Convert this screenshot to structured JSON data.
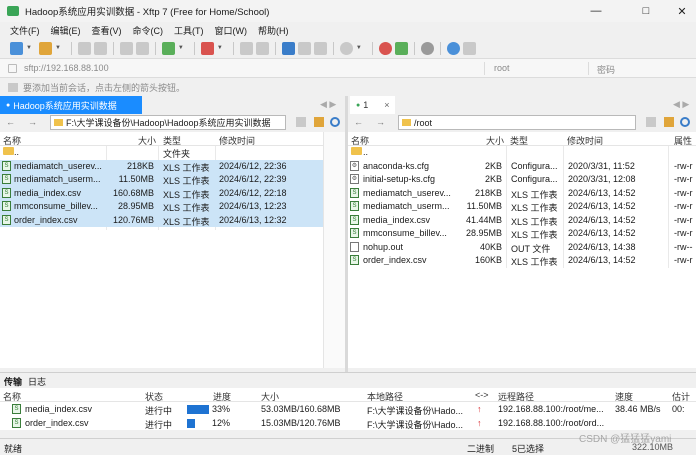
{
  "window": {
    "title": "Hadoop系统应用实训数据 - Xftp 7 (Free for Home/School)"
  },
  "menu": [
    "文件(F)",
    "编辑(E)",
    "查看(V)",
    "命令(C)",
    "工具(T)",
    "窗口(W)",
    "帮助(H)"
  ],
  "address": {
    "host_placeholder": "sftp://192.168.88.100",
    "user_placeholder": "root",
    "password_placeholder": "密码"
  },
  "hint": "要添加当前会话，点击左侧的箭头按钮。",
  "local": {
    "tab_label": "Hadoop系统应用实训数据",
    "path": "F:\\大学课设备份\\Hadoop\\Hadoop系统应用实训数据",
    "columns": {
      "name": "名称",
      "size": "大小",
      "type": "类型",
      "modified": "修改时间"
    },
    "rows": [
      {
        "name": "..",
        "size": "",
        "type": "文件夹",
        "modified": "",
        "kind": "folder"
      },
      {
        "name": "mediamatch_userev...",
        "size": "218KB",
        "type": "XLS 工作表",
        "modified": "2024/6/12, 22:36",
        "kind": "sheet"
      },
      {
        "name": "mediamatch_userm...",
        "size": "11.50MB",
        "type": "XLS 工作表",
        "modified": "2024/6/12, 22:39",
        "kind": "sheet"
      },
      {
        "name": "media_index.csv",
        "size": "160.68MB",
        "type": "XLS 工作表",
        "modified": "2024/6/12, 22:18",
        "kind": "sheet"
      },
      {
        "name": "mmconsume_billev...",
        "size": "28.95MB",
        "type": "XLS 工作表",
        "modified": "2024/6/13, 12:23",
        "kind": "sheet"
      },
      {
        "name": "order_index.csv",
        "size": "120.76MB",
        "type": "XLS 工作表",
        "modified": "2024/6/13, 12:32",
        "kind": "sheet"
      }
    ]
  },
  "remote": {
    "tab_label": "1",
    "path": "/root",
    "columns": {
      "name": "名称",
      "size": "大小",
      "type": "类型",
      "modified": "修改时间",
      "attr": "属性"
    },
    "rows": [
      {
        "name": "..",
        "size": "",
        "type": "",
        "modified": "",
        "attr": "",
        "kind": "folder"
      },
      {
        "name": "anaconda-ks.cfg",
        "size": "2KB",
        "type": "Configura...",
        "modified": "2020/3/31, 11:52",
        "attr": "-rw-r",
        "kind": "cfg"
      },
      {
        "name": "initial-setup-ks.cfg",
        "size": "2KB",
        "type": "Configura...",
        "modified": "2020/3/31, 12:08",
        "attr": "-rw-r",
        "kind": "cfg"
      },
      {
        "name": "mediamatch_userev...",
        "size": "218KB",
        "type": "XLS 工作表",
        "modified": "2024/6/13, 14:52",
        "attr": "-rw-r",
        "kind": "sheet"
      },
      {
        "name": "mediamatch_userm...",
        "size": "11.50MB",
        "type": "XLS 工作表",
        "modified": "2024/6/13, 14:52",
        "attr": "-rw-r",
        "kind": "sheet"
      },
      {
        "name": "media_index.csv",
        "size": "41.44MB",
        "type": "XLS 工作表",
        "modified": "2024/6/13, 14:52",
        "attr": "-rw-r",
        "kind": "sheet"
      },
      {
        "name": "mmconsume_billev...",
        "size": "28.95MB",
        "type": "XLS 工作表",
        "modified": "2024/6/13, 14:52",
        "attr": "-rw-r",
        "kind": "sheet"
      },
      {
        "name": "nohup.out",
        "size": "40KB",
        "type": "OUT 文件",
        "modified": "2024/6/13, 14:38",
        "attr": "-rw--",
        "kind": "file"
      },
      {
        "name": "order_index.csv",
        "size": "160KB",
        "type": "XLS 工作表",
        "modified": "2024/6/13, 14:52",
        "attr": "-rw-r",
        "kind": "sheet"
      }
    ]
  },
  "transfers": {
    "tabs": [
      "传输",
      "日志"
    ],
    "columns": {
      "name": "名称",
      "status": "状态",
      "progress": "进度",
      "size": "大小",
      "local_path": "本地路径",
      "direction": "<->",
      "remote_path": "远程路径",
      "speed": "速度",
      "estimate": "估计"
    },
    "rows": [
      {
        "name": "media_index.csv",
        "status": "进行中",
        "progress_pct": 33,
        "progress": "33%",
        "size": "53.03MB/160.68MB",
        "local_path": "F:\\大学课设备份\\Hado...",
        "remote_path": "192.168.88.100:/root/me...",
        "speed": "38.46 MB/s",
        "estimate": "00:"
      },
      {
        "name": "order_index.csv",
        "status": "进行中",
        "progress_pct": 12,
        "progress": "12%",
        "size": "15.03MB/120.76MB",
        "local_path": "F:\\大学课设备份\\Hado...",
        "remote_path": "192.168.88.100:/root/ord...",
        "speed": "",
        "estimate": ""
      }
    ]
  },
  "status": {
    "left": "就绪",
    "mode": "二进制",
    "selection": "5已选择",
    "size": "322.10MB",
    "watermark": "CSDN @猛猛猛yami"
  },
  "colors": {
    "accent": "#1e73d2",
    "selection": "#cce4f7",
    "tab_active": "#1a8cff"
  }
}
